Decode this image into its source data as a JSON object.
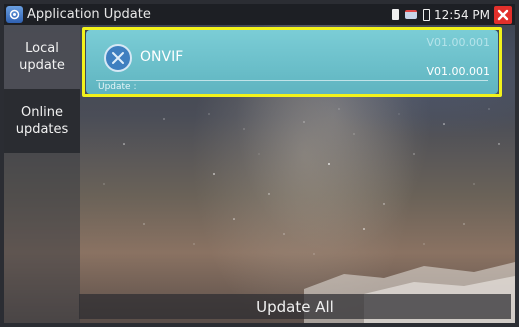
{
  "status_bar": {
    "title": "Application Update",
    "time": "12:54 PM"
  },
  "sidebar": {
    "items": [
      {
        "label": "Local\nupdate",
        "active": true
      },
      {
        "label": "Online\nupdates",
        "active": false
      }
    ]
  },
  "update_item": {
    "name": "ONVIF",
    "latest_version": "V01.00.001",
    "current_version": "V01.00.001",
    "status_label": "Update :"
  },
  "bottom": {
    "update_all_label": "Update All"
  },
  "colors": {
    "highlight": "#f2f21b",
    "card": "#6cc2cd",
    "close": "#e2302b"
  }
}
